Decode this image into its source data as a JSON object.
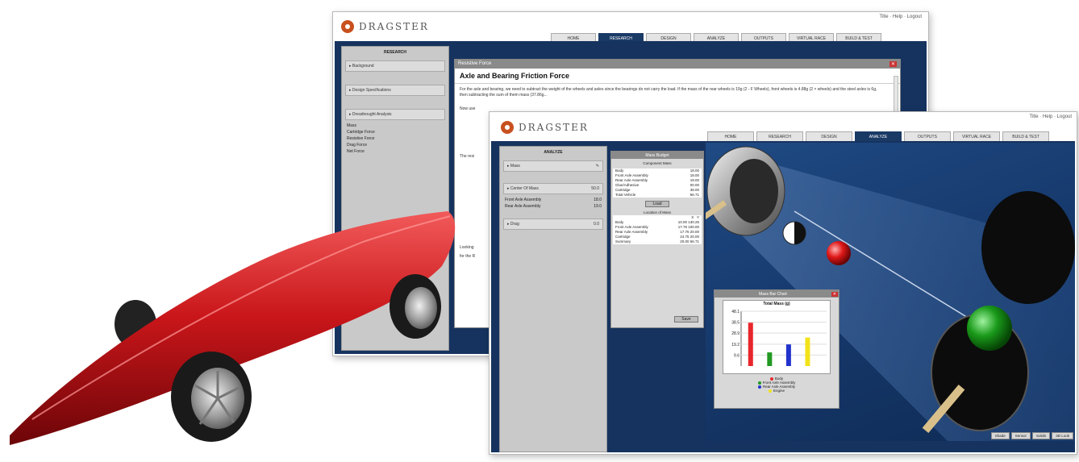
{
  "back_window": {
    "logo": "DRAGSTER",
    "top_links": "Title · Help · Logout",
    "tabs": [
      "HOME",
      "RESEARCH",
      "DESIGN",
      "ANALYZE",
      "OUTPUTS",
      "VIRTUAL RACE",
      "BUILD & TEST"
    ],
    "active_tab_index": 1,
    "sidebar": {
      "title": "RESEARCH",
      "sections": [
        "Background",
        "Design Specifications",
        "Dreadnought Analysis"
      ],
      "items": [
        "Mass",
        "Cartridge Force",
        "Resistive Force",
        "Drag Force",
        "Net Force"
      ]
    },
    "panel_title": "Resistive Force",
    "doc_heading": "Axle and Bearing Friction Force",
    "doc_paragraph": "For the axle and bearing, we need to subtract the weight of the wheels and axles since the bearings do not carry the load. If the mass of the rear wheels is 19g (2 - F Wheels), front wheels is 4.88g (2 × wheels) and the steel axles is 6g, then subtracting the sum of them mass (37.86g...",
    "doc_fragment_1": "Now use",
    "doc_fragment_2": "The resi",
    "doc_fragment_3": "Looking",
    "doc_fragment_4": "for the R"
  },
  "front_window": {
    "logo": "DRAGSTER",
    "top_links": "Title · Help · Logout",
    "tabs": [
      "HOME",
      "RESEARCH",
      "DESIGN",
      "ANALYZE",
      "OUTPUTS",
      "VIRTUAL RACE",
      "BUILD & TEST"
    ],
    "active_tab_index": 3,
    "sidebar": {
      "title": "ANALYZE",
      "sections": [
        "Mass",
        "Center Of Mass",
        "Drag"
      ],
      "items": [
        "Front Axle Assembly",
        "Rear Axle Assembly"
      ],
      "item_values": [
        "18.0",
        "19.0"
      ],
      "section_values": [
        "",
        "50.0",
        "0.0"
      ]
    },
    "mass_budget": {
      "title": "Mass Budget",
      "component_header": "Component Mass",
      "rows": [
        {
          "label": "Body",
          "value": "18.00"
        },
        {
          "label": "Front Axle Assembly",
          "value": "18.00"
        },
        {
          "label": "Rear Axle Assembly",
          "value": "19.00"
        },
        {
          "label": "Glue/Adhesive",
          "value": "00.00"
        },
        {
          "label": "Cartridge",
          "value": "38.00"
        },
        {
          "label": "Total Vehicle",
          "value": "56.71"
        }
      ],
      "load_button": "Load",
      "location_header": "Location of Mass",
      "loc_cols": [
        "X",
        "Y"
      ],
      "loc_rows": [
        {
          "label": "Body",
          "x": "10.00",
          "y": "130.25"
        },
        {
          "label": "Front Axle Assembly",
          "x": "17.76",
          "y": "100.00"
        },
        {
          "label": "Rear Axle Assembly",
          "x": "17.76",
          "y": "20.00"
        },
        {
          "label": "Cartridge",
          "x": "24.75",
          "y": "20.00"
        },
        {
          "label": "Summary",
          "x": "20.00",
          "y": "56.71"
        }
      ],
      "save_button": "Save"
    },
    "chart_popup": {
      "title": "Mass Bar Chart",
      "chart_title": "Total Mass (g)",
      "legend": [
        "Body",
        "Front Axle Assembly",
        "Rear Axle Assembly",
        "Engine"
      ],
      "colors": [
        "#e8262b",
        "#229922",
        "#2233cc",
        "#f2e21a"
      ]
    },
    "status_buttons": [
      "Shade",
      "Sensor",
      "Solids",
      "3D Look"
    ]
  },
  "chart_data": {
    "type": "bar",
    "title": "Total Mass (g)",
    "categories": [
      "Body",
      "Front Axle Assembly",
      "Rear Axle Assembly",
      "Engine"
    ],
    "values": [
      38,
      12,
      19,
      25
    ],
    "y_ticks": [
      "48.1",
      "38.5",
      "28.9",
      "19.2",
      "9.6"
    ],
    "ylim": [
      0,
      48.1
    ],
    "legend_position": "bottom"
  }
}
